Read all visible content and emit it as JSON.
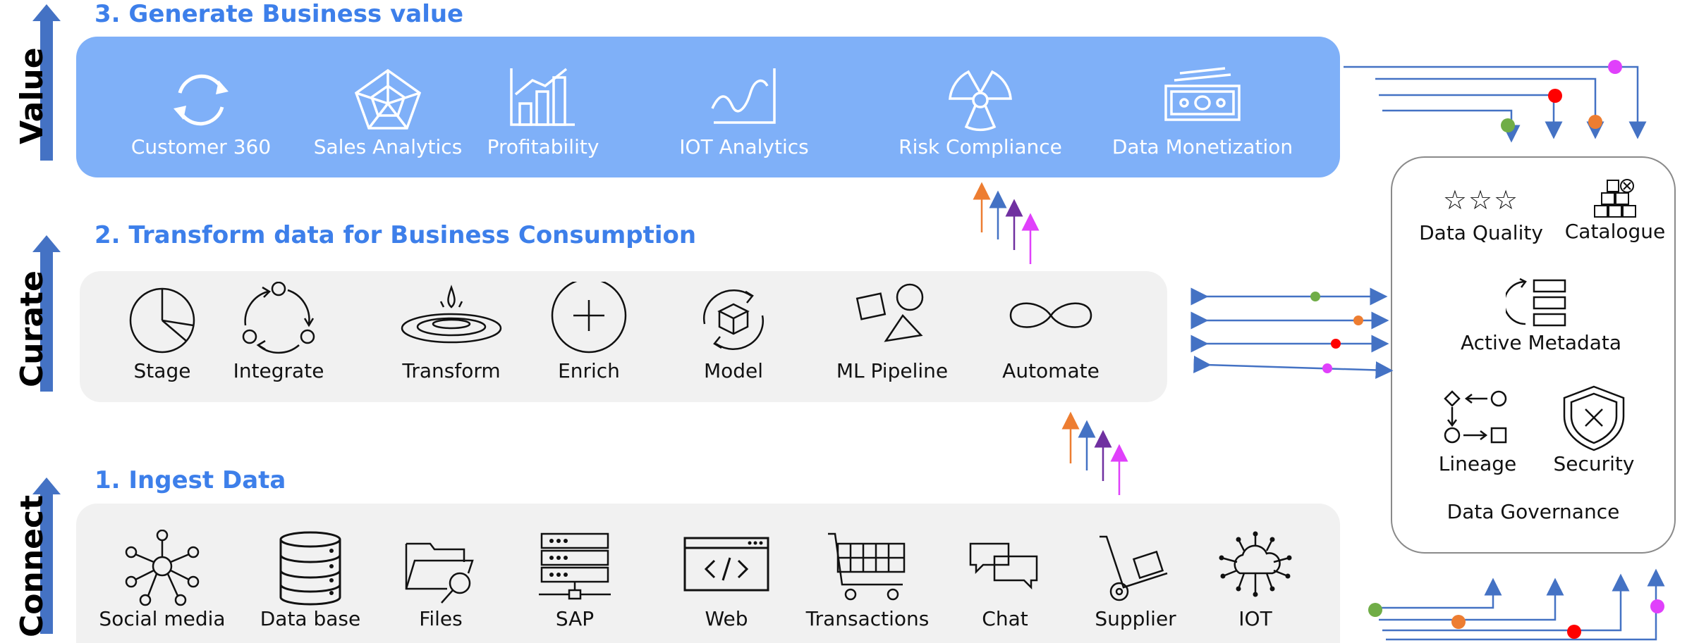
{
  "stages": {
    "value": "Value",
    "curate": "Curate",
    "connect": "Connect"
  },
  "sections": {
    "value_title": "3. Generate Business value",
    "curate_title": "2. Transform data for Business Consumption",
    "connect_title": "1. Ingest Data"
  },
  "value_items": [
    {
      "label": "Customer 360",
      "icon": "refresh-cycle-icon"
    },
    {
      "label": "Sales Analytics",
      "icon": "radar-web-icon"
    },
    {
      "label": "Profitability",
      "icon": "bar-chart-icon"
    },
    {
      "label": "IOT Analytics",
      "icon": "wave-chart-icon"
    },
    {
      "label": "Risk Compliance",
      "icon": "radiation-icon"
    },
    {
      "label": "Data Monetization",
      "icon": "banknotes-icon"
    }
  ],
  "curate_items": [
    {
      "label": "Stage",
      "icon": "pie-icon"
    },
    {
      "label": "Integrate",
      "icon": "integrate-cycle-icon"
    },
    {
      "label": "Transform",
      "icon": "water-drop-icon"
    },
    {
      "label": "Enrich",
      "icon": "plus-circle-icon"
    },
    {
      "label": "Model",
      "icon": "cube-cycle-icon"
    },
    {
      "label": "ML Pipeline",
      "icon": "shapes-icon"
    },
    {
      "label": "Automate",
      "icon": "infinity-icon"
    }
  ],
  "connect_items": [
    {
      "label": "Social media",
      "icon": "network-hub-icon"
    },
    {
      "label": "Data base",
      "icon": "database-icon"
    },
    {
      "label": "Files",
      "icon": "folder-search-icon"
    },
    {
      "label": "SAP",
      "icon": "server-icon"
    },
    {
      "label": "Web",
      "icon": "browser-code-icon"
    },
    {
      "label": "Transactions",
      "icon": "shopping-cart-icon"
    },
    {
      "label": "Chat",
      "icon": "chat-bubbles-icon"
    },
    {
      "label": "Supplier",
      "icon": "hand-truck-icon"
    },
    {
      "label": "IOT",
      "icon": "cloud-network-icon"
    }
  ],
  "governance": {
    "data_quality": "Data Quality",
    "quality_stars": "☆☆☆",
    "catalogue": "Catalogue",
    "active_metadata": "Active Metadata",
    "lineage": "Lineage",
    "security": "Security",
    "title": "Data Governance"
  },
  "colors": {
    "accent_blue": "#3d7fea",
    "arrow_blue": "#4472c4",
    "value_panel": "#7fb0f8",
    "light_panel": "#f1f1f1",
    "orange": "#ed7d31",
    "purple": "#7030a0",
    "magenta": "#e040fb",
    "green": "#70ad47",
    "red": "#ff0000"
  }
}
